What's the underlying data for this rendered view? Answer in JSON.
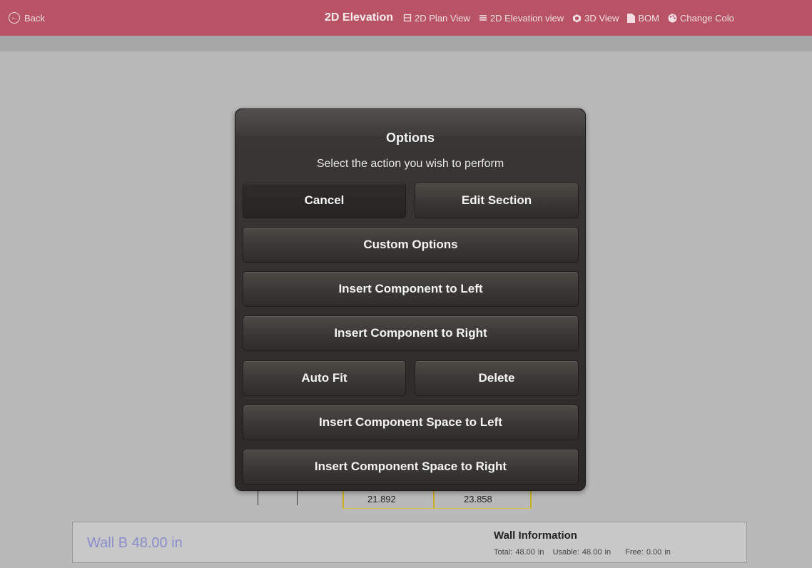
{
  "header": {
    "back_label": "Back",
    "title": "2D Elevation",
    "nav_items": [
      {
        "label": "2D Plan View",
        "icon": "plan-view-icon"
      },
      {
        "label": "2D Elevation view",
        "icon": "list-icon"
      },
      {
        "label": "3D View",
        "icon": "cube-icon"
      },
      {
        "label": "BOM",
        "icon": "document-icon"
      },
      {
        "label": "Change Colo",
        "icon": "palette-icon"
      }
    ]
  },
  "drawing": {
    "dimensions": [
      "21.892",
      "23.858"
    ]
  },
  "modal": {
    "title": "Options",
    "subtitle": "Select the action you wish to perform",
    "buttons": {
      "cancel": "Cancel",
      "edit_section": "Edit Section",
      "custom_options": "Custom Options",
      "insert_left": "Insert Component to Left",
      "insert_right": "Insert Component to Right",
      "auto_fit": "Auto Fit",
      "delete": "Delete",
      "insert_space_left": "Insert Component Space to Left",
      "insert_space_right": "Insert Component Space to Right"
    }
  },
  "wall": {
    "name": "Wall B 48.00 in",
    "info_title": "Wall Information",
    "total": "Total: 48.00 in",
    "usable": "Usable: 48.00 in",
    "free": "Free: 0.00 in"
  },
  "colors": {
    "header_bg": "#b85366",
    "wall_name": "#8a8ecb",
    "dimension_line": "#c9a82a"
  }
}
